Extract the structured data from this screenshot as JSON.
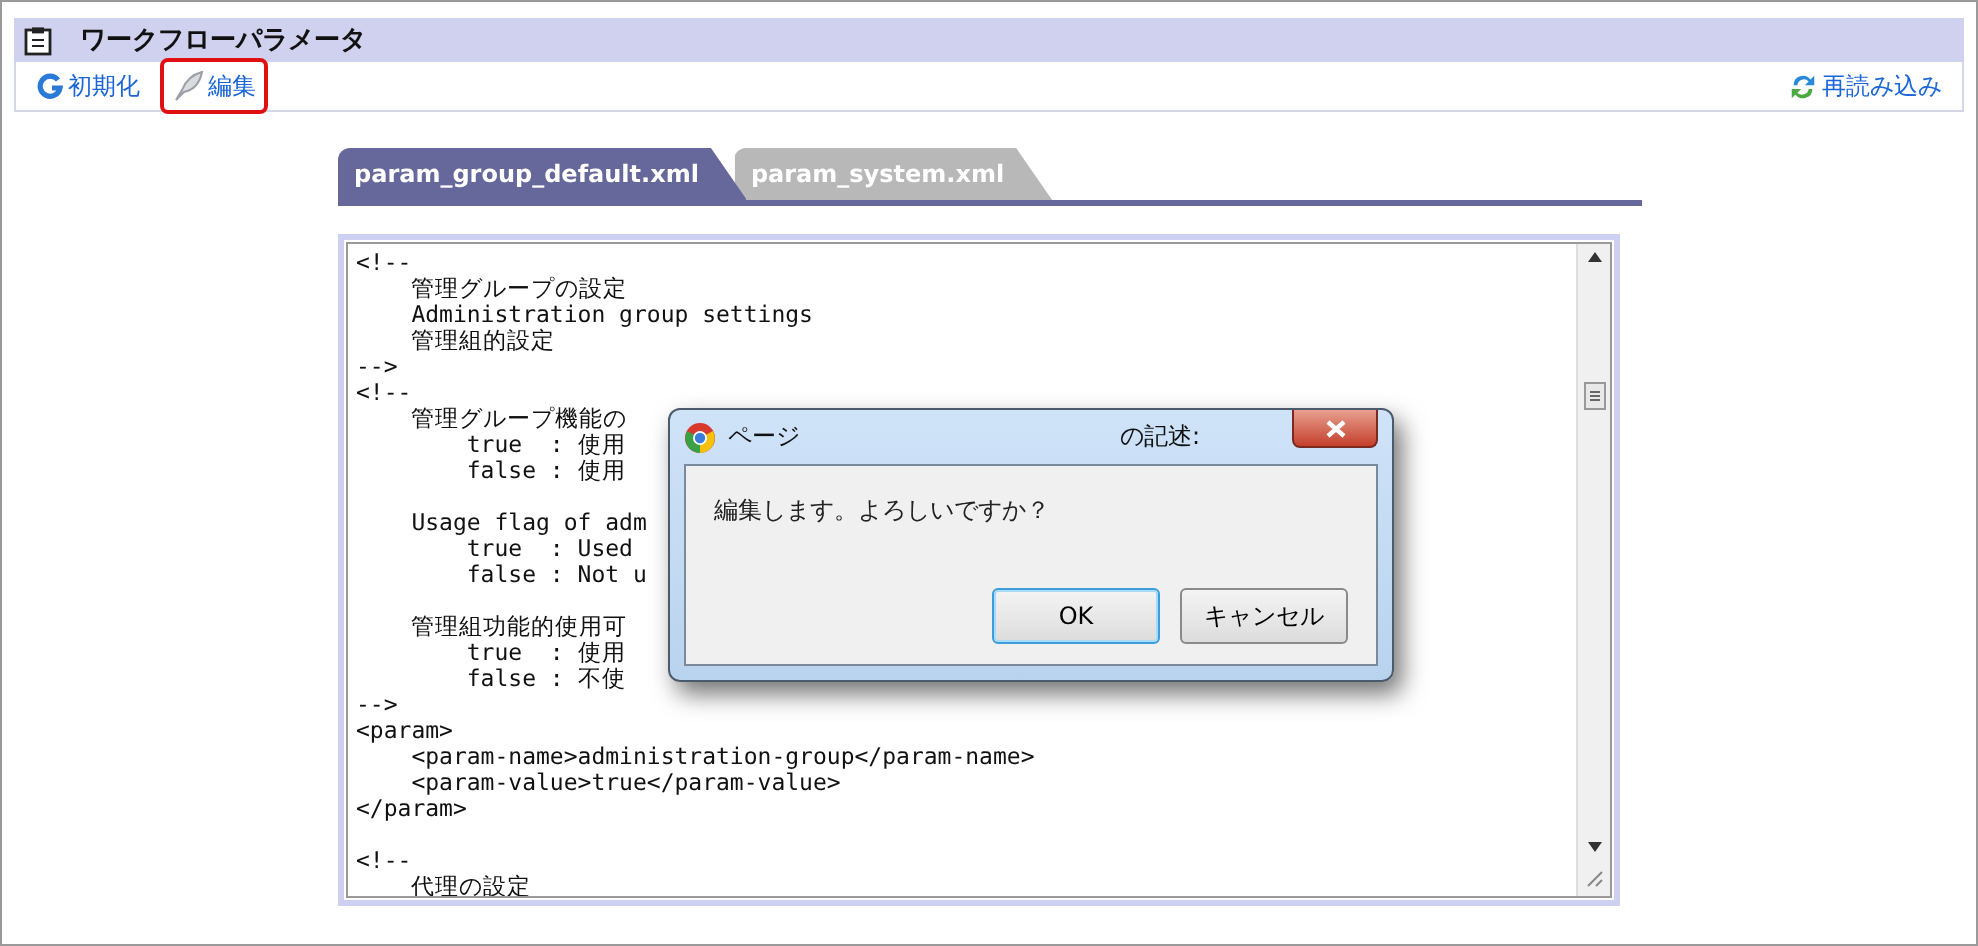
{
  "panel": {
    "title": "ワークフローパラメータ"
  },
  "toolbar": {
    "left": [
      {
        "kind": "reset",
        "label": "初期化",
        "highlighted": false
      },
      {
        "kind": "edit",
        "label": "編集",
        "highlighted": true
      }
    ],
    "right": [
      {
        "kind": "reload",
        "label": "再読み込み"
      }
    ]
  },
  "tabs": [
    {
      "label": "param_group_default.xml",
      "selected": true
    },
    {
      "label": "param_system.xml",
      "selected": false
    }
  ],
  "code_lines": [
    {
      "kind": "text",
      "text": "<!--"
    },
    {
      "kind": "text",
      "text": "    管理グループの設定"
    },
    {
      "kind": "text",
      "text": "    Administration group settings"
    },
    {
      "kind": "text",
      "text": "    管理組的設定"
    },
    {
      "kind": "text",
      "text": "-->"
    },
    {
      "kind": "text",
      "text": "<!--"
    },
    {
      "kind": "text",
      "text": "    管理グループ機能の"
    },
    {
      "kind": "text",
      "text": "        true  : 使用"
    },
    {
      "kind": "text",
      "text": "        false : 使用"
    },
    {
      "kind": "blank"
    },
    {
      "kind": "text",
      "text": "    Usage flag of adm"
    },
    {
      "kind": "text",
      "text": "        true  : Used"
    },
    {
      "kind": "text",
      "text": "        false : Not u"
    },
    {
      "kind": "blank"
    },
    {
      "kind": "text",
      "text": "    管理組功能的使用可"
    },
    {
      "kind": "text",
      "text": "        true  : 使用"
    },
    {
      "kind": "text",
      "text": "        false : 不使"
    },
    {
      "kind": "text",
      "text": "-->"
    },
    {
      "kind": "text",
      "text": "<param>"
    },
    {
      "kind": "text",
      "text": "    <param-name>administration-group</param-name>"
    },
    {
      "kind": "text",
      "text": "    <param-value>true</param-value>"
    },
    {
      "kind": "text",
      "text": "</param>"
    },
    {
      "kind": "blank"
    },
    {
      "kind": "text",
      "text": "<!--"
    },
    {
      "kind": "text",
      "text": "    代理の設定"
    }
  ],
  "dialog": {
    "title_left": "ページ",
    "title_right": "の記述:",
    "message": "編集します。よろしいですか？",
    "buttons": [
      {
        "label": "OK",
        "selected": true
      },
      {
        "label": "キャンセル",
        "selected": false
      }
    ]
  }
}
